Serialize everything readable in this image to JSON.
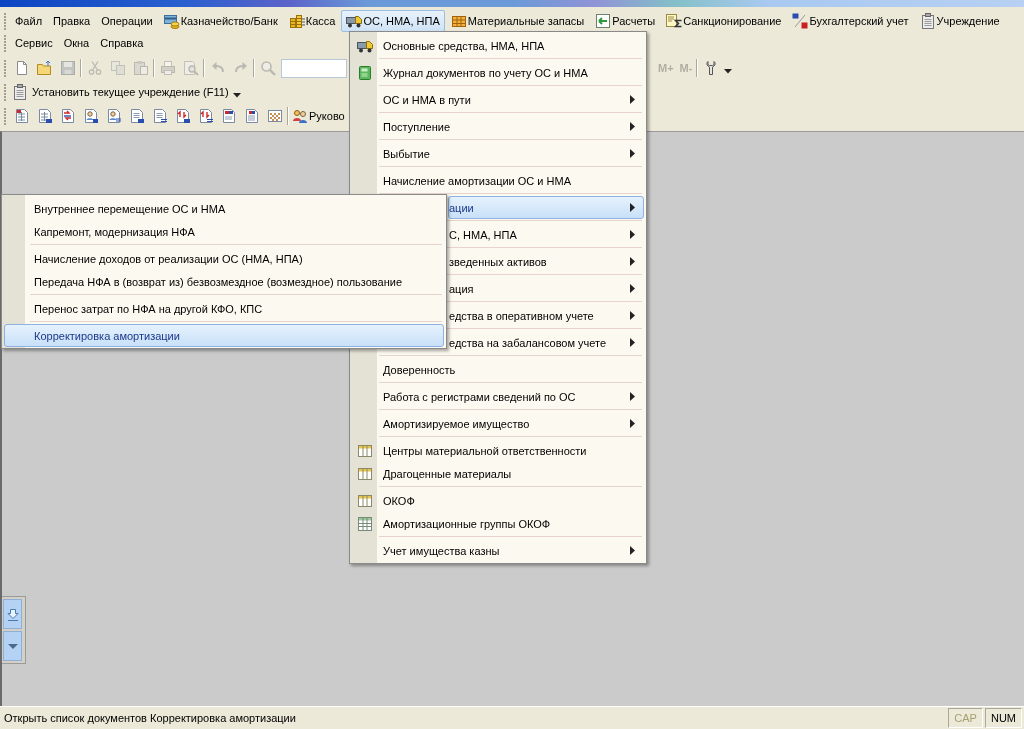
{
  "menu_bar": {
    "rows": [
      [
        {
          "label": "Файл",
          "selected": false
        },
        {
          "label": "Правка",
          "selected": false
        },
        {
          "label": "Операции",
          "selected": false
        },
        {
          "label": "Казначейство/Банк",
          "selected": false
        },
        {
          "label": "Касса",
          "selected": false
        },
        {
          "label": "ОС, НМА, НПА",
          "selected": true
        },
        {
          "label": "Материальные запасы",
          "selected": false
        },
        {
          "label": "Расчеты",
          "selected": false
        },
        {
          "label": "Санкционирование",
          "selected": false
        },
        {
          "label": "Бухгалтерский учет",
          "selected": false
        },
        {
          "label": "Учреждение",
          "selected": false
        }
      ],
      [
        {
          "label": "Сервис",
          "selected": false
        },
        {
          "label": "Окна",
          "selected": false
        },
        {
          "label": "Справка",
          "selected": false
        }
      ]
    ]
  },
  "standard_toolbar": {
    "items": [
      {
        "kind": "button",
        "disabled": false
      },
      {
        "kind": "button",
        "disabled": false
      },
      {
        "kind": "button",
        "disabled": true
      },
      {
        "kind": "separator"
      },
      {
        "kind": "button",
        "disabled": true
      },
      {
        "kind": "button",
        "disabled": true
      },
      {
        "kind": "button",
        "disabled": true
      },
      {
        "kind": "separator"
      },
      {
        "kind": "button",
        "disabled": true
      },
      {
        "kind": "button",
        "disabled": true
      },
      {
        "kind": "separator"
      },
      {
        "kind": "button",
        "disabled": true
      },
      {
        "kind": "button",
        "disabled": true
      },
      {
        "kind": "separator"
      },
      {
        "kind": "button",
        "disabled": true
      },
      {
        "kind": "field"
      },
      {
        "kind": "text_button",
        "label": "M+",
        "disabled": true
      },
      {
        "kind": "text_button",
        "label": "M-",
        "disabled": true
      },
      {
        "kind": "separator"
      },
      {
        "kind": "button",
        "disabled": false
      },
      {
        "kind": "dropdown"
      }
    ]
  },
  "org_toolbar": {
    "label": "Установить текущее учреждение (F11)"
  },
  "reports_toolbar": {
    "items": [
      {
        "kind": "button"
      },
      {
        "kind": "button"
      },
      {
        "kind": "button"
      },
      {
        "kind": "button"
      },
      {
        "kind": "button"
      },
      {
        "kind": "button"
      },
      {
        "kind": "button"
      },
      {
        "kind": "button"
      },
      {
        "kind": "button"
      },
      {
        "kind": "button"
      },
      {
        "kind": "button"
      },
      {
        "kind": "button"
      },
      {
        "kind": "separator"
      },
      {
        "kind": "labeled_button",
        "label": "Руково"
      }
    ]
  },
  "os_menu": {
    "groups": [
      [
        {
          "label": "Основные средства, НМА, НПА",
          "has_submenu": false,
          "selected": false
        }
      ],
      [
        {
          "label": "Журнал документов по учету ОС и НМА",
          "has_submenu": false,
          "selected": false
        }
      ],
      [
        {
          "label": "ОС и НМА в пути",
          "has_submenu": true,
          "selected": false
        }
      ],
      [
        {
          "label": "Поступление",
          "has_submenu": true,
          "selected": false
        }
      ],
      [
        {
          "label": "Выбытие",
          "has_submenu": true,
          "selected": false
        }
      ],
      [
        {
          "label": "Начисление амортизации ОС и НМА",
          "has_submenu": false,
          "selected": false
        }
      ],
      [
        {
          "label": "ации",
          "has_submenu": true,
          "selected": true
        }
      ],
      [
        {
          "label": "С, НМА, НПА",
          "has_submenu": true,
          "selected": false
        }
      ],
      [
        {
          "label": "зведенных активов",
          "has_submenu": true,
          "selected": false
        }
      ],
      [
        {
          "label": "ация",
          "has_submenu": true,
          "selected": false
        }
      ],
      [
        {
          "label": "едства в оперативном учете",
          "has_submenu": true,
          "selected": false
        }
      ],
      [
        {
          "label": "едства на забалансовом учете",
          "has_submenu": true,
          "selected": false
        }
      ],
      [
        {
          "label": "Доверенность",
          "has_submenu": false,
          "selected": false
        }
      ],
      [
        {
          "label": "Работа с регистрами сведений по ОС",
          "has_submenu": true,
          "selected": false
        }
      ],
      [
        {
          "label": "Амортизируемое имущество",
          "has_submenu": true,
          "selected": false
        }
      ],
      [
        {
          "label": "Центры материальной ответственности",
          "has_submenu": false,
          "selected": false
        },
        {
          "label": "Драгоценные материалы",
          "has_submenu": false,
          "selected": false
        }
      ],
      [
        {
          "label": "ОКОФ",
          "has_submenu": false,
          "selected": false
        },
        {
          "label": "Амортизационные группы ОКОФ",
          "has_submenu": false,
          "selected": false
        }
      ],
      [
        {
          "label": "Учет имущества казны",
          "has_submenu": true,
          "selected": false
        }
      ]
    ]
  },
  "submenu": {
    "groups": [
      [
        {
          "label": "Внутреннее перемещение ОС и НМА",
          "selected": false
        },
        {
          "label": "Капремонт, модернизация НФА",
          "selected": false
        }
      ],
      [
        {
          "label": "Начисление доходов от реализации ОС (НМА, НПА)",
          "selected": false
        },
        {
          "label": "Передача НФА в (возврат из) безвозмездное (возмездное) пользование",
          "selected": false
        }
      ],
      [
        {
          "label": "Перенос затрат по НФА на другой КФО, КПС",
          "selected": false
        }
      ],
      [
        {
          "label": "Корректировка амортизации",
          "selected": true
        }
      ]
    ]
  },
  "status_bar": {
    "message": "Открыть список документов Корректировка амортизации",
    "indicators": [
      {
        "label": "CAP",
        "on": false
      },
      {
        "label": "NUM",
        "on": true
      }
    ]
  }
}
